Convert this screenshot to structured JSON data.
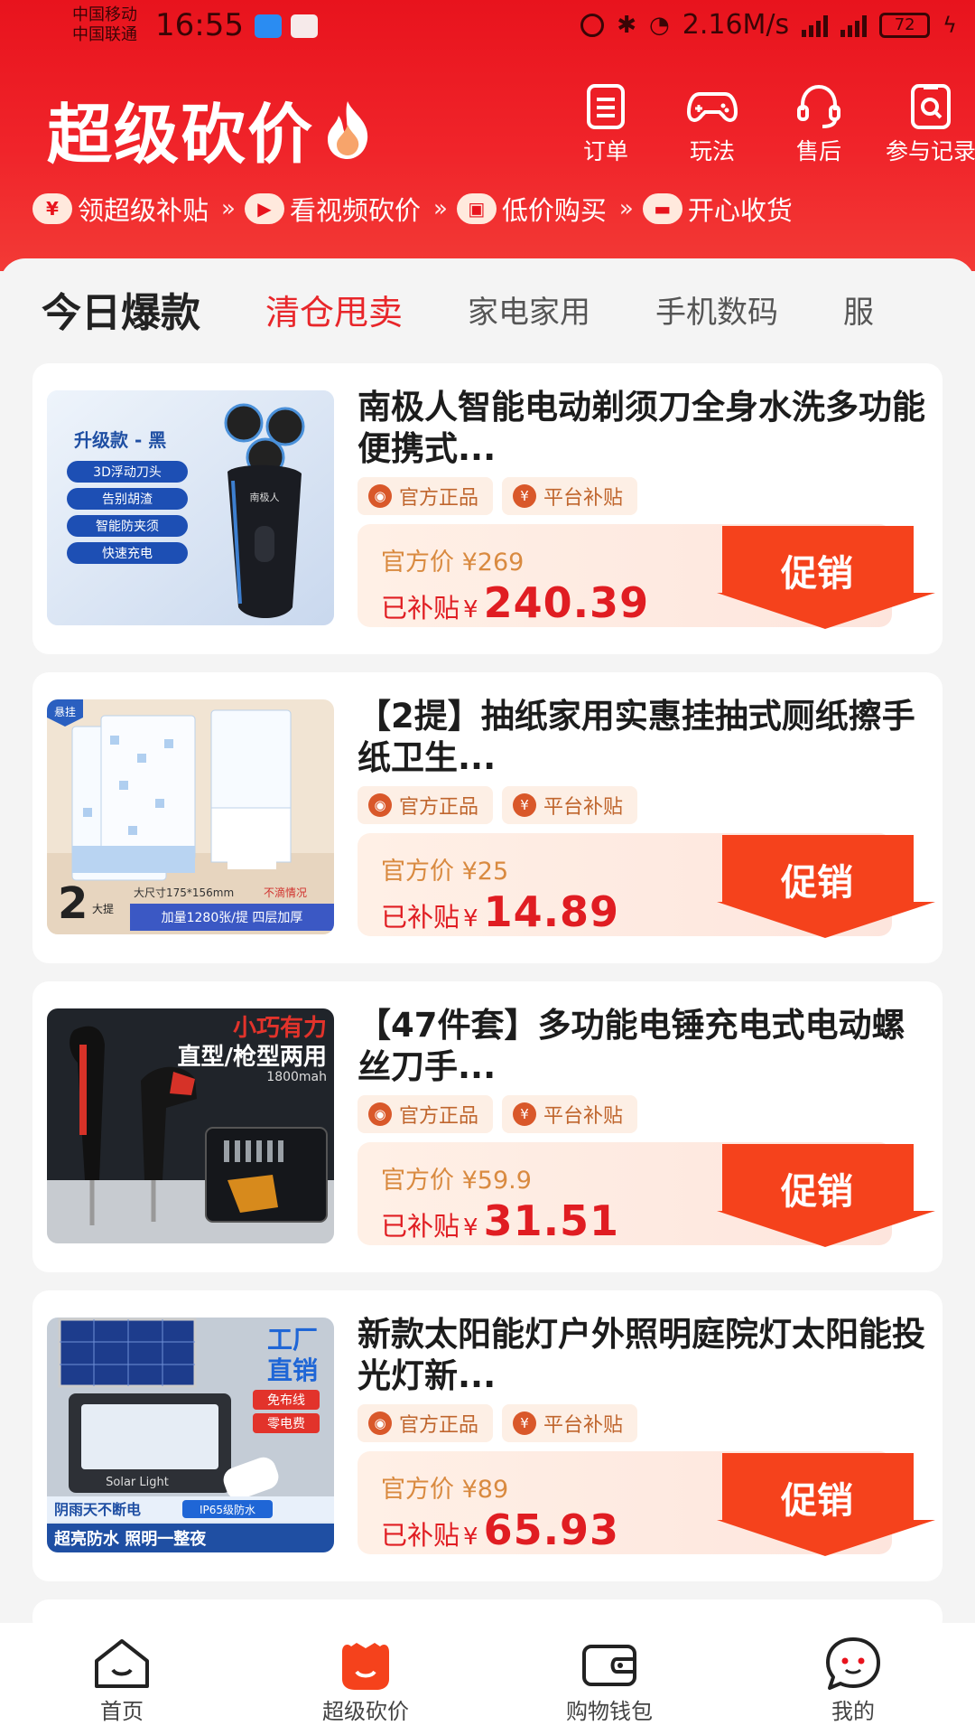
{
  "status_bar": {
    "carrier_1": "中国移动",
    "carrier_2": "中国联通",
    "time": "16:55",
    "net_speed": "2.16M/s",
    "battery": "72"
  },
  "header": {
    "title": "超级砍价",
    "actions": [
      {
        "label": "订单",
        "icon": "order-list-icon"
      },
      {
        "label": "玩法",
        "icon": "gamepad-icon"
      },
      {
        "label": "售后",
        "icon": "headset-icon"
      },
      {
        "label": "参与记录",
        "icon": "record-search-icon"
      }
    ],
    "steps": [
      {
        "label": "领超级补贴",
        "icon": "yen-coin-icon",
        "glyph": "¥"
      },
      {
        "label": "看视频砍价",
        "icon": "video-icon",
        "glyph": "▶"
      },
      {
        "label": "低价购买",
        "icon": "shopping-bag-icon",
        "glyph": "▣"
      },
      {
        "label": "开心收货",
        "icon": "wallet-icon",
        "glyph": "▬"
      }
    ],
    "step_separator": "»"
  },
  "tabs": [
    "今日爆款",
    "清仓甩卖",
    "家电家用",
    "手机数码",
    "服"
  ],
  "active_tab": 1,
  "products": [
    {
      "title": "南极人智能电动剃须刀全身水洗多功能便携式...",
      "tags": [
        "官方正品",
        "平台补贴"
      ],
      "orig_price_label": "官方价 ¥269",
      "subsidy_label": "已补贴",
      "currency": "¥",
      "price": "240.39",
      "button": "促销",
      "image_text": {
        "heading": "升级款 - 黑",
        "features": [
          "3D浮动刀头",
          "告别胡渣",
          "智能防夹须",
          "快速充电"
        ],
        "brand": "南极人"
      }
    },
    {
      "title": "【2提】抽纸家用实惠挂抽式厕纸擦手纸卫生...",
      "tags": [
        "官方正品",
        "平台补贴"
      ],
      "orig_price_label": "官方价 ¥25",
      "subsidy_label": "已补贴",
      "currency": "¥",
      "price": "14.89",
      "button": "促销",
      "image_text": {
        "badge": "悬挂",
        "big": "2",
        "big_unit": "大提",
        "size": "大尺寸175*156mm",
        "note": "不滴情况",
        "strip": "加量1280张/提  四层加厚"
      }
    },
    {
      "title": "【47件套】多功能电锤充电式电动螺丝刀手...",
      "tags": [
        "官方正品",
        "平台补贴"
      ],
      "orig_price_label": "官方价 ¥59.9",
      "subsidy_label": "已补贴",
      "currency": "¥",
      "price": "31.51",
      "button": "促销",
      "image_text": {
        "line1": "小巧有力",
        "line2": "直型/枪型两用",
        "line3": "1800mah"
      }
    },
    {
      "title": "新款太阳能灯户外照明庭院灯太阳能投光灯新...",
      "tags": [
        "官方正品",
        "平台补贴"
      ],
      "orig_price_label": "官方价 ¥89",
      "subsidy_label": "已补贴",
      "currency": "¥",
      "price": "65.93",
      "button": "促销",
      "image_text": {
        "tag1": "工厂",
        "tag2": "直销",
        "badge1": "免布线",
        "badge2": "零电费",
        "lamp": "Solar Light",
        "strip1": "阴雨天不断电",
        "strip1b": "IP65级防水",
        "strip2": "超亮防水 照明一整夜"
      }
    }
  ],
  "bottom_nav": [
    {
      "label": "首页",
      "icon": "home-icon"
    },
    {
      "label": "超级砍价",
      "icon": "bargain-icon"
    },
    {
      "label": "购物钱包",
      "icon": "wallet-icon"
    },
    {
      "label": "我的",
      "icon": "profile-icon"
    }
  ],
  "active_nav": 1,
  "colors": {
    "brand_red": "#e8131d",
    "price_red": "#e01d22",
    "promo_orange": "#f5421c",
    "tag_text": "#c0662e"
  }
}
